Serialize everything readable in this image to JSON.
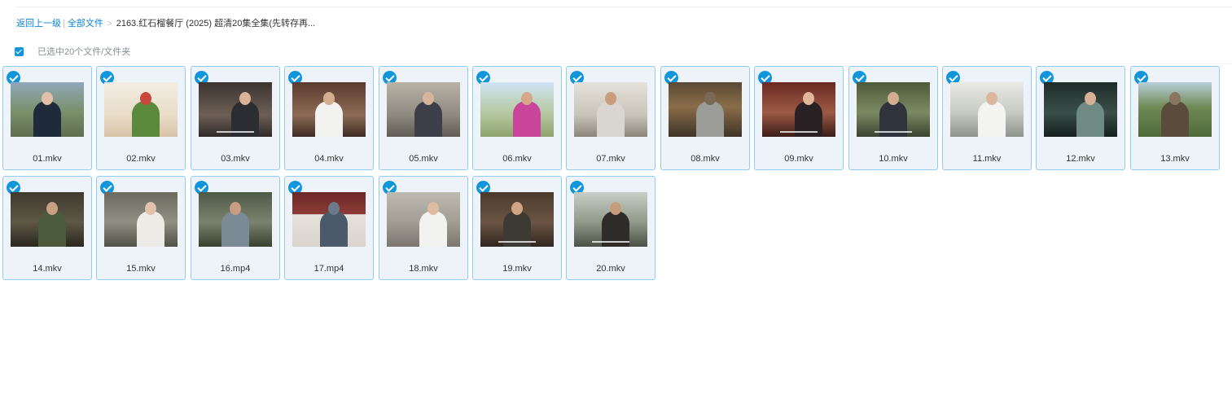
{
  "breadcrumb": {
    "back": "返回上一级",
    "sep": "|",
    "all_files": "全部文件",
    "arrow": ">",
    "current": "2163.红石榴餐厅 (2025) 超清20集全集(先转存再..."
  },
  "selection": {
    "text": "已选中20个文件/文件夹"
  },
  "colors": {
    "accent": "#1296db",
    "tile_bg": "#eef3f9",
    "tile_border": "#8fcdf2",
    "link": "#0b84d8"
  },
  "files": [
    {
      "name": "01.mkv",
      "thumb": {
        "bg": "linear-gradient(180deg,#8fa8b8 0%,#7a8f6a 55%,#5f6e4e 100%)",
        "figure": "#1f2a3a",
        "face": "#e2c0a6",
        "sub": false
      }
    },
    {
      "name": "02.mkv",
      "thumb": {
        "bg": "linear-gradient(180deg,#f2ede3 0%,#e9dcc8 60%,#d8c3a7 100%)",
        "figure": "#5c8a3c",
        "face": "#c9483e",
        "sub": false
      }
    },
    {
      "name": "03.mkv",
      "thumb": {
        "bg": "linear-gradient(180deg,#3b3430 0%,#6d5f55 60%,#2f2a28 100%)",
        "figure": "#2b2d33",
        "face": "#d9b298",
        "sub": true
      }
    },
    {
      "name": "04.mkv",
      "thumb": {
        "bg": "linear-gradient(180deg,#5a3b2e 0%,#8d6a55 60%,#3f2c25 100%)",
        "figure": "#f1f1ef",
        "face": "#d6ad8f",
        "sub": false
      }
    },
    {
      "name": "05.mkv",
      "thumb": {
        "bg": "linear-gradient(180deg,#b9b2a6 0%,#8e8a80 60%,#5f5b55 100%)",
        "figure": "#3c3f48",
        "face": "#d8b49b",
        "sub": false
      }
    },
    {
      "name": "06.mkv",
      "thumb": {
        "bg": "linear-gradient(180deg,#cfe4f3 0%,#b7c9a3 55%,#8fa36f 100%)",
        "figure": "#c8459a",
        "face": "#d6a889",
        "sub": false
      }
    },
    {
      "name": "07.mkv",
      "thumb": {
        "bg": "linear-gradient(180deg,#e4e2dc 0%,#c9c4b9 60%,#8a8479 100%)",
        "figure": "#d9d6cf",
        "face": "#c99c7e",
        "sub": false
      }
    },
    {
      "name": "08.mkv",
      "thumb": {
        "bg": "linear-gradient(180deg,#5a4a35 0%,#8a6d4a 45%,#3f3427 100%)",
        "figure": "#9b9b98",
        "face": "#7a6a55",
        "sub": false
      }
    },
    {
      "name": "09.mkv",
      "thumb": {
        "bg": "linear-gradient(180deg,#6b2a22 0%,#9c5a44 55%,#3b1d18 100%)",
        "figure": "#2a2124",
        "face": "#e0b79a",
        "sub": true
      }
    },
    {
      "name": "10.mkv",
      "thumb": {
        "bg": "linear-gradient(180deg,#4e5a3c 0%,#7a8a62 55%,#3a4330 100%)",
        "figure": "#2f343c",
        "face": "#d3ad92",
        "sub": true
      }
    },
    {
      "name": "11.mkv",
      "thumb": {
        "bg": "linear-gradient(180deg,#e9e9e6 0%,#c8cbc4 55%,#8d938b 100%)",
        "figure": "#f3f3f1",
        "face": "#dcb79e",
        "sub": false
      }
    },
    {
      "name": "12.mkv",
      "thumb": {
        "bg": "linear-gradient(180deg,#1f2c2a 0%,#3a4f4a 55%,#17201f 100%)",
        "figure": "#6e8a82",
        "face": "#d7b096",
        "sub": false
      }
    },
    {
      "name": "13.mkv",
      "thumb": {
        "bg": "linear-gradient(180deg,#b8cfdc 0%,#6f8a55 45%,#4f6a3a 100%)",
        "figure": "#5b4b3a",
        "face": "#8a7560",
        "sub": false
      }
    },
    {
      "name": "14.mkv",
      "thumb": {
        "bg": "linear-gradient(180deg,#3e3a2f 0%,#5e5744 55%,#2a2720 100%)",
        "figure": "#4a5a3a",
        "face": "#c9a083",
        "sub": false
      }
    },
    {
      "name": "15.mkv",
      "thumb": {
        "bg": "linear-gradient(180deg,#6b6b5f 0%,#8f8f83 55%,#4f5047 100%)",
        "figure": "#ecebe6",
        "face": "#e3c1aa",
        "sub": false
      }
    },
    {
      "name": "16.mp4",
      "thumb": {
        "bg": "linear-gradient(180deg,#4d5a48 0%,#7a826f 55%,#39402f 100%)",
        "figure": "#7c8a96",
        "face": "#c99d80",
        "sub": false
      }
    },
    {
      "name": "17.mp4",
      "thumb": {
        "bg": "linear-gradient(180deg,#6a2826 0%,#8c3b36 40%,#e6e2dc 41%,#d9d4cc 100%)",
        "figure": "#4a5a6a",
        "face": "#6b7b8b",
        "sub": false
      }
    },
    {
      "name": "18.mkv",
      "thumb": {
        "bg": "linear-gradient(180deg,#bdbab2 0%,#a19d94 55%,#7a766f 100%)",
        "figure": "#f2f2ef",
        "face": "#dfbba2",
        "sub": false
      }
    },
    {
      "name": "19.mkv",
      "thumb": {
        "bg": "linear-gradient(180deg,#4a3a2c 0%,#6b5443 55%,#2f2620 100%)",
        "figure": "#3d3a34",
        "face": "#d0a585",
        "sub": true
      }
    },
    {
      "name": "20.mkv",
      "thumb": {
        "bg": "linear-gradient(180deg,#c8cec6 0%,#8f9a8a 55%,#4b5046 100%)",
        "figure": "#2e2b28",
        "face": "#c79c7d",
        "sub": true
      }
    }
  ]
}
